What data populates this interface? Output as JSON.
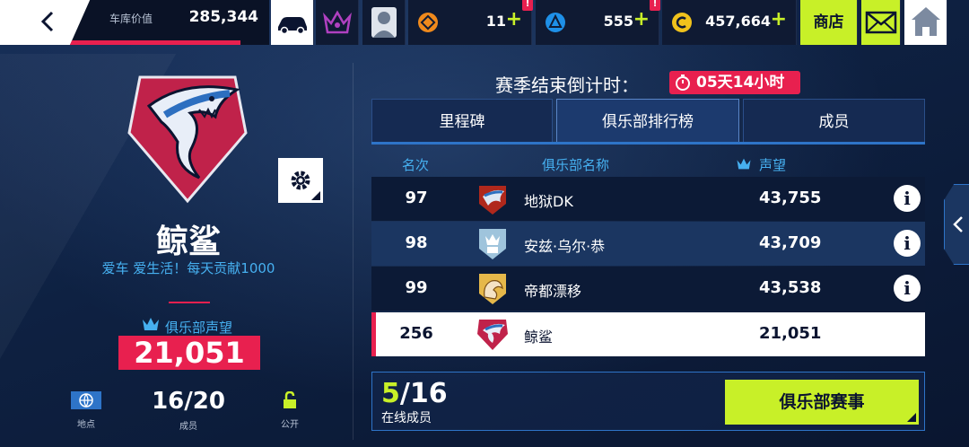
{
  "topbar": {
    "garage_value_label": "车库价值",
    "garage_value": "285,344",
    "currency1_value": "11",
    "currency2_value": "555",
    "currency3_value": "457,664",
    "alert_mark": "!",
    "plus_mark": "+",
    "shop_label": "商店"
  },
  "club": {
    "name": "鲸鲨",
    "motto": "爱车 爱生活！每天贡献1000",
    "reputation_label": "俱乐部声望",
    "reputation": "21,051",
    "location_label": "地点",
    "members": "16/20",
    "members_label": "成员",
    "access_label": "公开"
  },
  "season": {
    "countdown_label": "赛季结束倒计时：",
    "countdown_value": "05天14小时"
  },
  "tabs": [
    {
      "label": "里程碑"
    },
    {
      "label": "俱乐部排行榜"
    },
    {
      "label": "成员"
    }
  ],
  "table": {
    "headers": {
      "rank": "名次",
      "name": "俱乐部名称",
      "reputation": "声望"
    },
    "rows": [
      {
        "rank": "97",
        "name": "地狱DK",
        "reputation": "43,755"
      },
      {
        "rank": "98",
        "name": "安兹·乌尔·恭",
        "reputation": "43,709"
      },
      {
        "rank": "99",
        "name": "帝都漂移",
        "reputation": "43,538"
      },
      {
        "rank": "256",
        "name": "鲸鲨",
        "reputation": "21,051"
      }
    ],
    "info_glyph": "i"
  },
  "online": {
    "current": "5",
    "total": "/16",
    "label": "在线成员"
  },
  "event_button": "俱乐部赛事",
  "colors": {
    "accent_red": "#e8204f",
    "accent_lime": "#c8f028",
    "accent_blue": "#46b0f0"
  }
}
